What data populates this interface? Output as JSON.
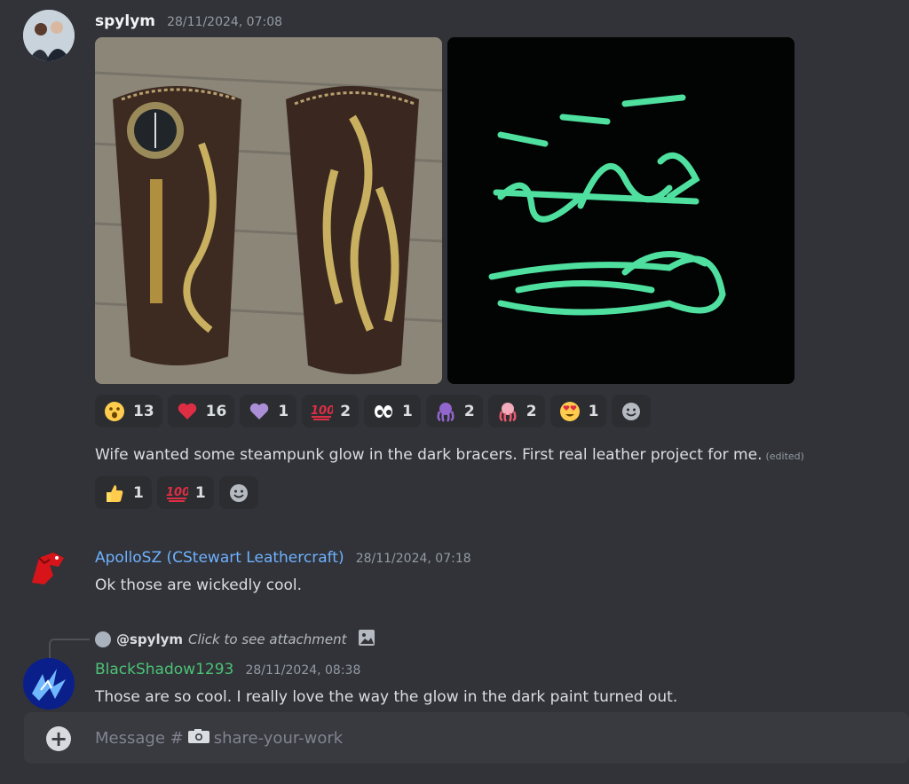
{
  "colors": {
    "bg": "#313338",
    "apollo": "#6fb1ff",
    "blackshadow": "#4cc276",
    "timestamp": "#949ba4"
  },
  "messages": [
    {
      "username": "spylym",
      "timestamp": "28/11/2024, 07:08",
      "text": "Wife wanted some steampunk glow in the dark bracers. First real leather project for me.",
      "edited": "(edited)",
      "attachments": [
        {
          "desc": "Leather bracers with compass and octopus"
        },
        {
          "desc": "Glow in the dark octopus bracers"
        }
      ],
      "reactions": [
        {
          "emoji": "hushed-face-icon",
          "count": "13"
        },
        {
          "emoji": "red-heart-icon",
          "count": "16"
        },
        {
          "emoji": "purple-heart-icon",
          "count": "1"
        },
        {
          "emoji": "hundred-icon",
          "count": "2"
        },
        {
          "emoji": "eyes-icon",
          "count": "1"
        },
        {
          "emoji": "purple-octopus-icon",
          "count": "2"
        },
        {
          "emoji": "red-octopus-icon",
          "count": "2"
        },
        {
          "emoji": "heart-eyes-icon",
          "count": "1"
        }
      ],
      "text_reactions": [
        {
          "emoji": "thumbs-up-icon",
          "count": "1"
        },
        {
          "emoji": "hundred-icon",
          "count": "1"
        }
      ]
    },
    {
      "username": "ApolloSZ (CStewart Leathercraft)",
      "timestamp": "28/11/2024, 07:18",
      "text": "Ok those are wickedly cool."
    },
    {
      "reply_to": "@spylym",
      "reply_text": "Click to see attachment",
      "username": "BlackShadow1293",
      "timestamp": "28/11/2024, 08:38",
      "text": "Those are so cool. I really love the way the glow in the dark paint turned out."
    }
  ],
  "composer": {
    "prefix": "Message #",
    "channel": "share-your-work"
  }
}
